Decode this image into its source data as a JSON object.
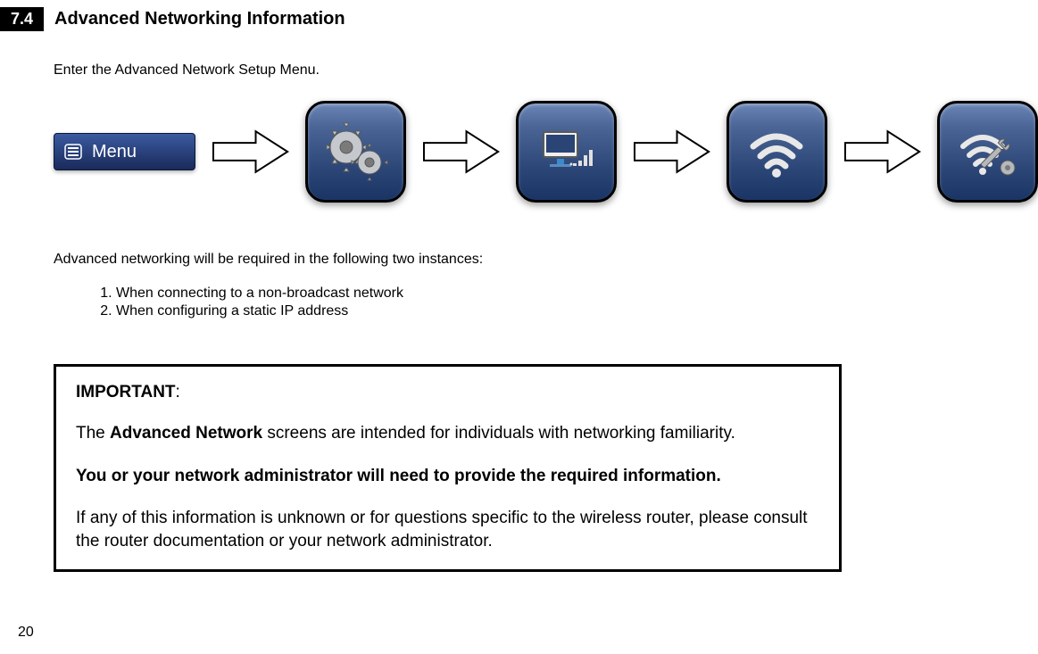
{
  "header": {
    "section_number": "7.4",
    "section_title": "Advanced Networking Information"
  },
  "instruction": "Enter the Advanced Network Setup Menu.",
  "menu": {
    "label": "Menu"
  },
  "instances": {
    "intro": "Advanced networking will be required in the following two instances:",
    "item1": "When connecting to a non-broadcast network",
    "item2": "When configuring a static IP address"
  },
  "important": {
    "title": "IMPORTANT",
    "title_colon": ":",
    "line1_prefix": "The ",
    "line1_bold": "Advanced Network",
    "line1_suffix": " screens are intended for individuals with networking familiarity.",
    "line2": "You or your network administrator will need to provide the required information.",
    "line3": "If any of this information is unknown or for questions specific to the wireless router, please consult the router documentation or your network administrator."
  },
  "page_number": "20"
}
